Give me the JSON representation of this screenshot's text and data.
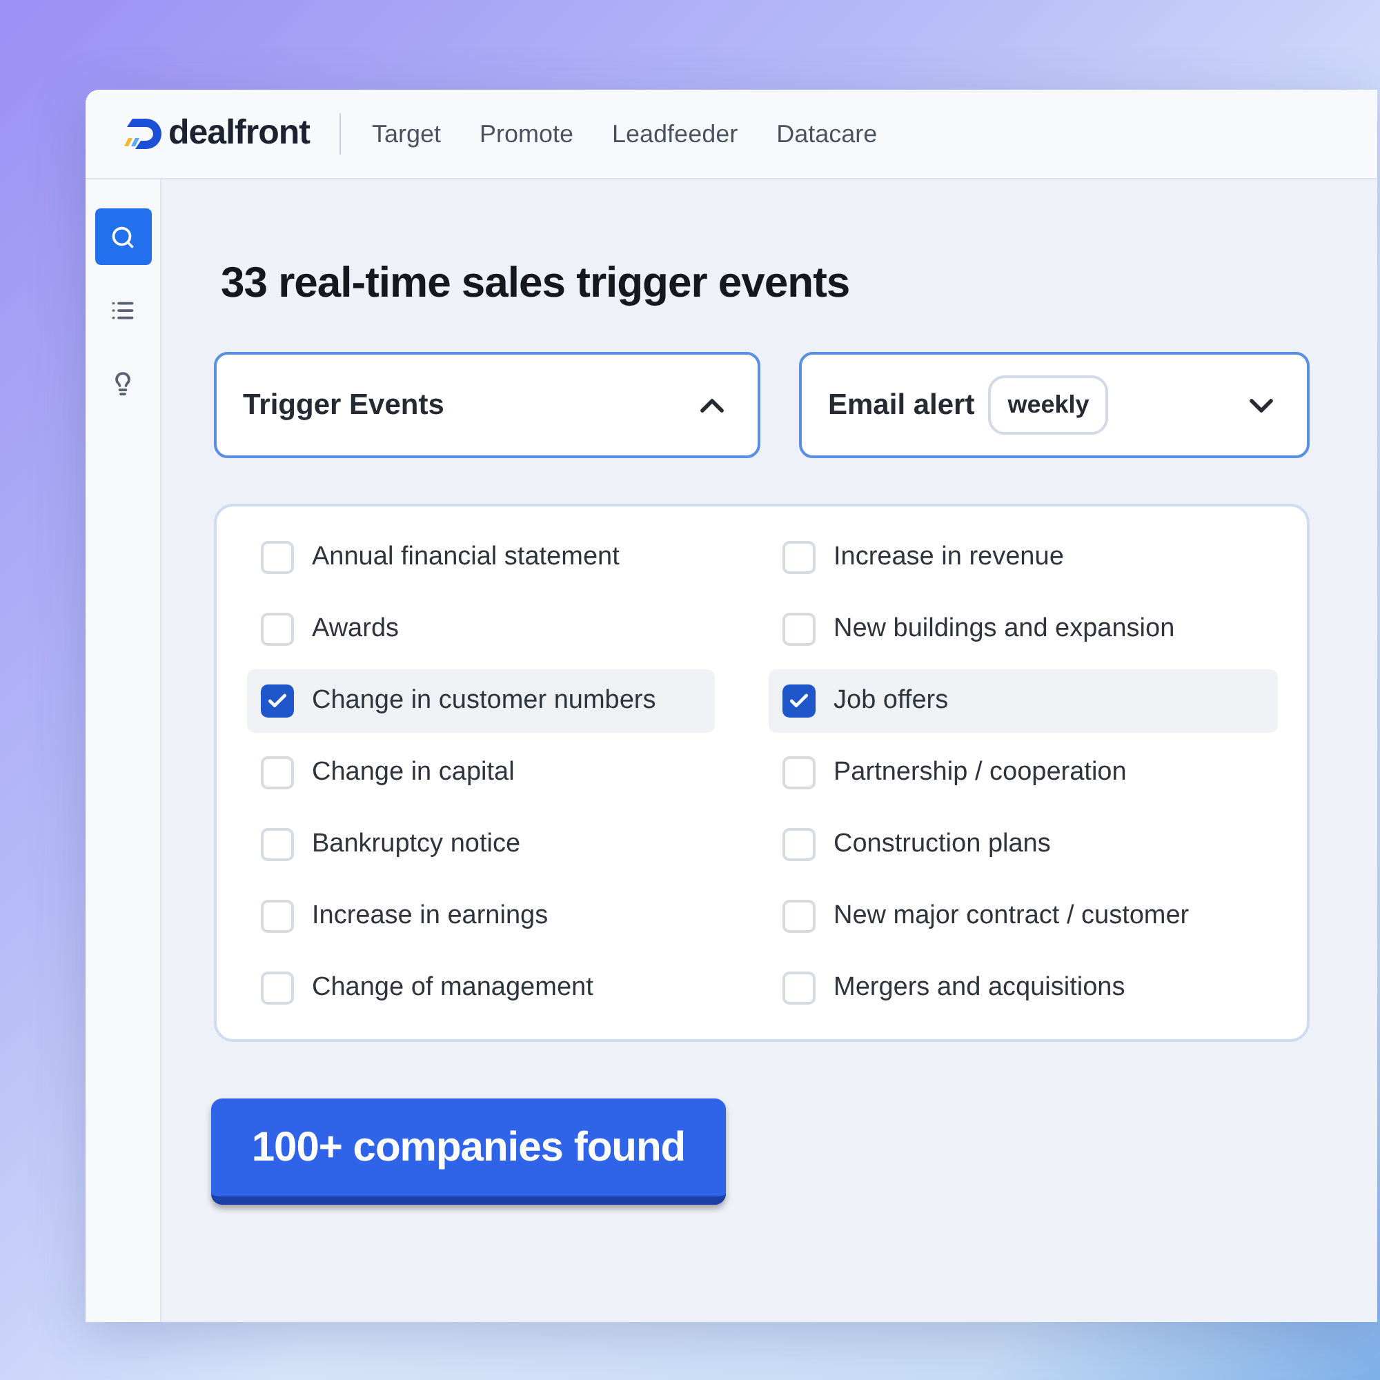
{
  "header": {
    "brand": "dealfront",
    "nav": [
      {
        "label": "Target"
      },
      {
        "label": "Promote"
      },
      {
        "label": "Leadfeeder"
      },
      {
        "label": "Datacare"
      }
    ]
  },
  "sidebar": {
    "items": [
      {
        "kind": "search",
        "selected": true
      },
      {
        "kind": "list",
        "selected": false
      },
      {
        "kind": "bulb",
        "selected": false
      }
    ]
  },
  "title": "33 real-time sales trigger events",
  "filters": [
    {
      "label": "Trigger Events",
      "expanded": true
    },
    {
      "label": "Email alert",
      "badge": "weekly",
      "expanded": false
    }
  ],
  "options": [
    {
      "label": "Annual financial statement",
      "checked": false
    },
    {
      "label": "Increase in revenue",
      "checked": false
    },
    {
      "label": "Awards",
      "checked": false
    },
    {
      "label": "New buildings and expansion",
      "checked": false
    },
    {
      "label": "Change in customer numbers",
      "checked": true
    },
    {
      "label": "Job offers",
      "checked": true
    },
    {
      "label": "Change in capital",
      "checked": false
    },
    {
      "label": "Partnership / cooperation",
      "checked": false
    },
    {
      "label": "Bankruptcy notice",
      "checked": false
    },
    {
      "label": "Construction plans",
      "checked": false
    },
    {
      "label": "Increase in earnings",
      "checked": false
    },
    {
      "label": "New major contract / customer",
      "checked": false
    },
    {
      "label": "Change of management",
      "checked": false
    },
    {
      "label": "Mergers and acquisitions",
      "checked": false
    }
  ],
  "result_button": "100+ companies found"
}
